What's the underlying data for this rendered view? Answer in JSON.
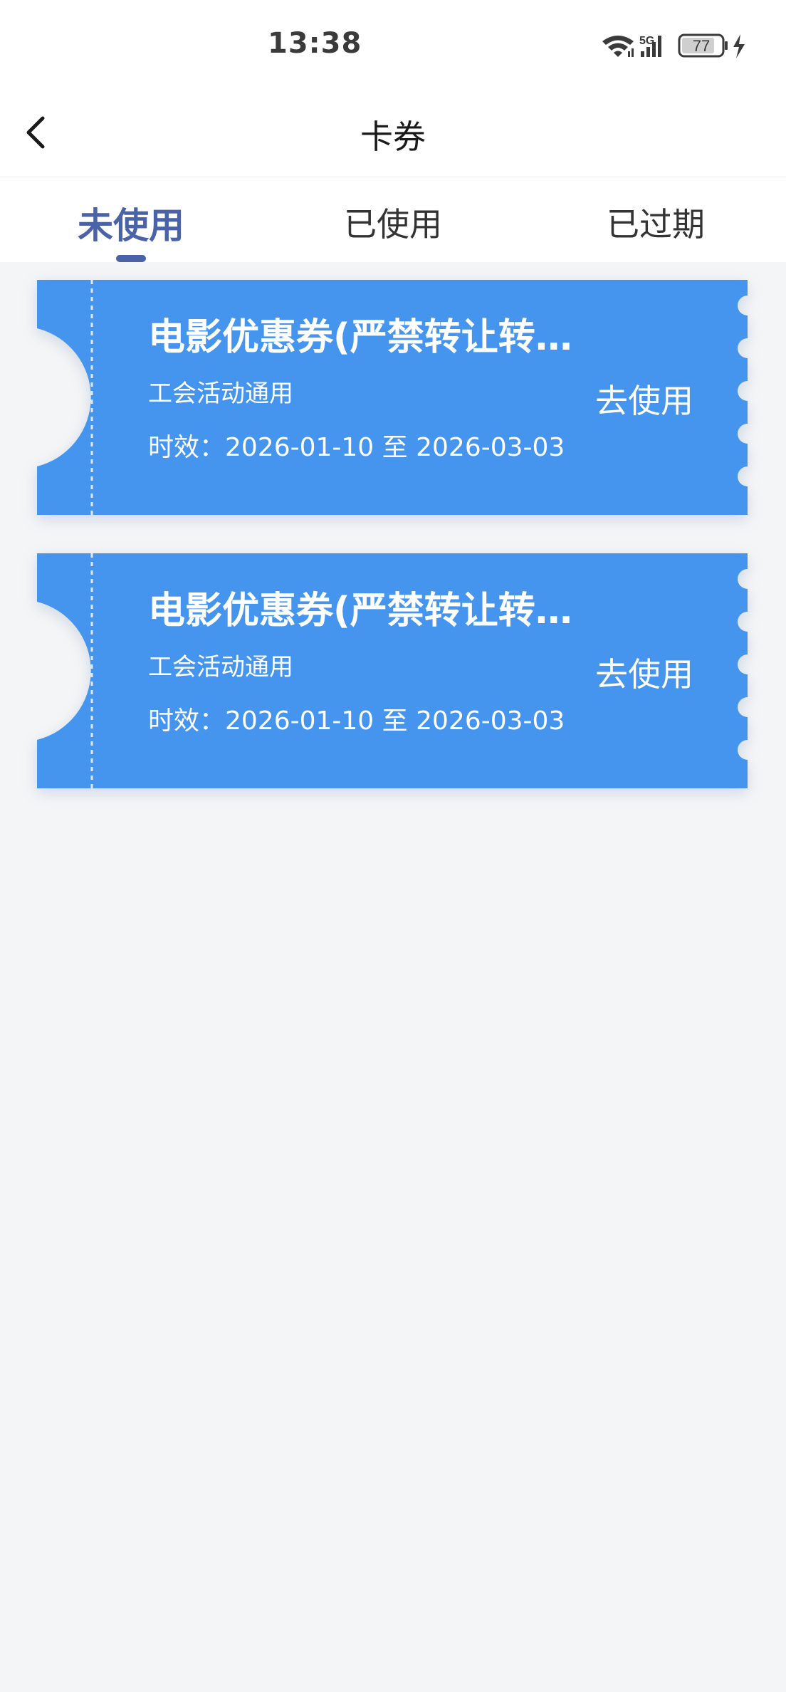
{
  "status_bar": {
    "time": "13:38",
    "network": "5G",
    "battery": "77",
    "icons": [
      "wifi-icon",
      "signal-icon",
      "battery-icon",
      "charging-icon"
    ]
  },
  "nav": {
    "title": "卡券",
    "back_icon": "chevron-left-icon"
  },
  "tabs": [
    {
      "label": "未使用",
      "active": true
    },
    {
      "label": "已使用",
      "active": false
    },
    {
      "label": "已过期",
      "active": false
    }
  ],
  "coupons": [
    {
      "title": "电影优惠券(严禁转让转…",
      "subtitle": "工会活动通用",
      "validity": "时效：2026-01-10 至 2026-03-03",
      "action": "去使用"
    },
    {
      "title": "电影优惠券(严禁转让转…",
      "subtitle": "工会活动通用",
      "validity": "时效：2026-01-10 至 2026-03-03",
      "action": "去使用"
    }
  ],
  "colors": {
    "accent": "#4a63a8",
    "coupon": "#4595ef",
    "background": "#f4f5f6"
  }
}
